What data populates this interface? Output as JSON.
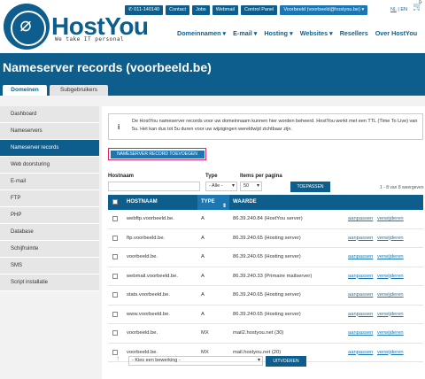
{
  "brand": {
    "name": "HostYou",
    "tagline": "We take IT personal",
    "color": "#0d5e8c"
  },
  "topbar": {
    "phone": "011-140140",
    "contact": "Contact",
    "jobs": "Jobs",
    "webmail": "Webmail",
    "control_panel": "Control Panel",
    "user": "Voorbeeld (voorbeeld@hostyou.be)",
    "lang_nl": "NL",
    "lang_en": "EN",
    "cart_count": "0"
  },
  "mainnav": [
    "Domeinnamen",
    "E-mail",
    "Hosting",
    "Websites",
    "Resellers",
    "Over HostYou"
  ],
  "page_title": "Nameserver records (voorbeeld.be)",
  "tabs": {
    "active": "Domeinen",
    "inactive": "Subgebruikers"
  },
  "sidebar": [
    "Dashboard",
    "Nameservers",
    "Nameserver records",
    "Web doorsturing",
    "E-mail",
    "FTP",
    "PHP",
    "Database",
    "Schijfruimte",
    "SMS",
    "Script installatie"
  ],
  "info": {
    "icon": "i",
    "text": "De HostYou nameserver records voor uw domeinnaam kunnen hier worden beheerd. HostYou werkt met een TTL (Time To Live) van 5u. Het kan dus tot 5u duren voor uw wijzigingen wereldwijd zichtbaar zijn."
  },
  "add_button": "NAMESERVER RECORD TOEVOEGEN",
  "filters": {
    "hostnaam_label": "Hostnaam",
    "hostnaam_value": "",
    "type_label": "Type",
    "type_value": "- Alle -",
    "items_label": "Items per pagina",
    "items_value": "50",
    "apply": "TOEPASSEN",
    "count": "1 - 8 van 8 weergeven"
  },
  "table": {
    "headers": {
      "hostnaam": "HOSTNAAM",
      "type": "TYPE",
      "waarde": "WAARDE"
    },
    "action_edit": "aanpassen",
    "action_delete": "verwijderen",
    "rows": [
      {
        "host": "webftp.voorbeeld.be.",
        "type": "A",
        "value": "86.39.240.84 (HostYou server)"
      },
      {
        "host": "ftp.voorbeeld.be.",
        "type": "A",
        "value": "86.39.240.65 (Hosting server)"
      },
      {
        "host": "voorbeeld.be.",
        "type": "A",
        "value": "86.39.240.65 (Hosting server)"
      },
      {
        "host": "webmail.voorbeeld.be.",
        "type": "A",
        "value": "86.39.240.33 (Primaire mailserver)"
      },
      {
        "host": "stats.voorbeeld.be.",
        "type": "A",
        "value": "86.39.240.65 (Hosting server)"
      },
      {
        "host": "www.voorbeeld.be.",
        "type": "A",
        "value": "86.39.240.65 (Hosting server)"
      },
      {
        "host": "voorbeeld.be.",
        "type": "MX",
        "value": "mail2.hostyou.net (30)"
      },
      {
        "host": "voorbeeld.be.",
        "type": "MX",
        "value": "mail.hostyou.net (20)"
      }
    ]
  },
  "bulk": {
    "placeholder": "- Kies een bewerking -",
    "execute": "UITVOEREN"
  }
}
